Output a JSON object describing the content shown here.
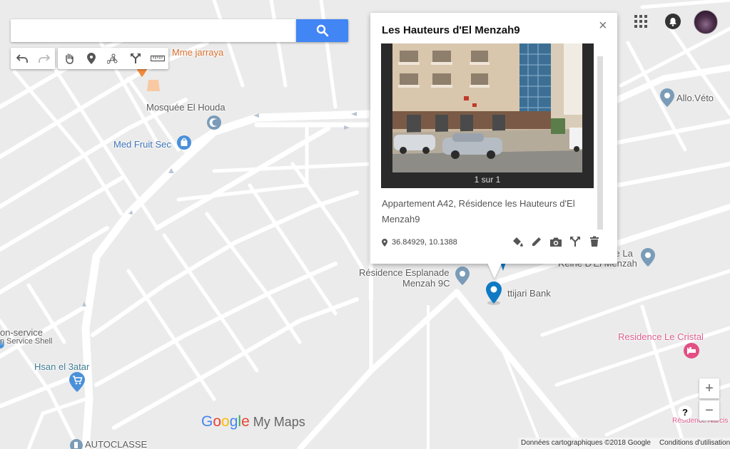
{
  "search": {
    "placeholder": "",
    "value": ""
  },
  "toolbar": {
    "items": [
      "undo-icon",
      "redo-icon",
      "hand-icon",
      "marker-icon",
      "draw-line-icon",
      "directions-icon",
      "ruler-icon"
    ]
  },
  "labels": {
    "mme_jarraya": "Mme jarraya",
    "mosquee": "Mosquée El Houda",
    "med_fruit": "Med Fruit Sec",
    "allo_veto": "Allo.Véto",
    "esplanade_1": "Résidence Esplanade",
    "esplanade_2": "Menzah 9C",
    "attijari": "ttijari Bank",
    "reine_1": "ce La",
    "reine_2": "Reine D'El Menzah",
    "cristal": "Residence Le Cristal",
    "narcis": "Résidence Narcis",
    "service_1": "on-service",
    "service_2": "n Service Shell",
    "hsan": "Hsan el 3atar",
    "autoclasse": "AUTOCLASSE"
  },
  "info_window": {
    "title": "Les Hauteurs d'El Menzah9",
    "photo_counter": "1 sur 1",
    "description": "Appartement A42, Résidence les Hauteurs d'El Menzah9",
    "coordinates": "36.84929, 10.1388",
    "actions": [
      "paint-bucket-icon",
      "edit-icon",
      "camera-icon",
      "directions-icon",
      "delete-icon"
    ]
  },
  "zoom": {
    "in": "+",
    "out": "−"
  },
  "help": "?",
  "branding": {
    "google": "Google",
    "mymaps": "My Maps"
  },
  "attribution": {
    "data": "Données cartographiques ©2018 Google",
    "terms": "Conditions d'utilisation"
  },
  "colors": {
    "map_bg": "#ebebeb",
    "road": "#ffffff",
    "accent_blue": "#4285f4",
    "marker_blue": "#0f7ac3",
    "poi_orange": "#f28a3d",
    "poi_pink": "#e34e84",
    "poi_grey_blue": "#7b9cb8"
  }
}
